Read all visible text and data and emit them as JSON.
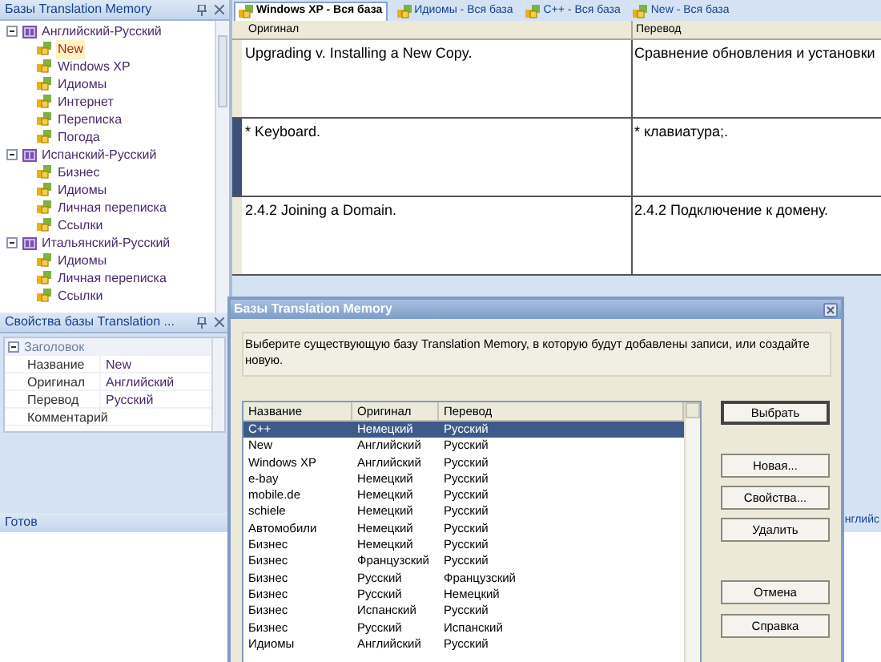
{
  "tm_panel": {
    "title": "Базы Translation Memory",
    "tree": [
      {
        "label": "Английский-Русский",
        "expanded": true,
        "children": [
          {
            "label": "New",
            "selected": true
          },
          {
            "label": "Windows XP",
            "selected": false
          },
          {
            "label": "Идиомы",
            "selected": false
          },
          {
            "label": "Интернет",
            "selected": false
          },
          {
            "label": "Переписка",
            "selected": false
          },
          {
            "label": "Погода",
            "selected": false
          }
        ]
      },
      {
        "label": "Испанский-Русский",
        "expanded": true,
        "children": [
          {
            "label": "Бизнес",
            "selected": false
          },
          {
            "label": "Идиомы",
            "selected": false
          },
          {
            "label": "Личная переписка",
            "selected": false
          },
          {
            "label": "Ссылки",
            "selected": false
          }
        ]
      },
      {
        "label": "Итальянский-Русский",
        "expanded": true,
        "children": [
          {
            "label": "Идиомы",
            "selected": false
          },
          {
            "label": "Личная переписка",
            "selected": false
          },
          {
            "label": "Ссылки",
            "selected": false
          }
        ]
      }
    ]
  },
  "props_panel": {
    "title": "Свойства базы Translation ...",
    "category": "Заголовок",
    "rows": [
      {
        "name": "Название",
        "value": "New"
      },
      {
        "name": "Оригинал",
        "value": "Английский"
      },
      {
        "name": "Перевод",
        "value": "Русский"
      },
      {
        "name": "Комментарий"
      }
    ]
  },
  "status_bar": {
    "text": "Готов",
    "right_text": "нглийс"
  },
  "tabs": [
    {
      "label": "Windows XP - Вся база",
      "selected": true
    },
    {
      "label": "Идиомы - Вся база",
      "selected": false
    },
    {
      "label": "C++ - Вся база",
      "selected": false
    },
    {
      "label": "New - Вся база",
      "selected": false
    }
  ],
  "table": {
    "columns": [
      "Оригинал",
      "Перевод"
    ],
    "rows": [
      {
        "original": "Upgrading v. Installing a New Copy.",
        "translation": "Сравнение обновления и установки",
        "selected": false
      },
      {
        "original": "* Keyboard.",
        "translation": "* клавиатура;.",
        "selected": true
      },
      {
        "original": "2.4.2   Joining a Domain.",
        "translation": "2.4.2 Подключение к домену.",
        "selected": false
      }
    ]
  },
  "dialog": {
    "title": "Базы Translation Memory",
    "message": "Выберите существующую базу Translation Memory, в которую будут добавлены записи, или создайте новую.",
    "columns": [
      "Название",
      "Оригинал",
      "Перевод"
    ],
    "rows": [
      {
        "name": "C++",
        "original": "Немецкий",
        "translation": "Русский",
        "selected": true
      },
      {
        "name": "New",
        "original": "Английский",
        "translation": "Русский",
        "selected": false
      },
      {
        "name": "Windows XP",
        "original": "Английский",
        "translation": "Русский",
        "selected": false
      },
      {
        "name": "e-bay",
        "original": "Немецкий",
        "translation": "Русский",
        "selected": false
      },
      {
        "name": "mobile.de",
        "original": "Немецкий",
        "translation": "Русский",
        "selected": false
      },
      {
        "name": "schiele",
        "original": "Немецкий",
        "translation": "Русский",
        "selected": false
      },
      {
        "name": "Автомобили",
        "original": "Немецкий",
        "translation": "Русский",
        "selected": false
      },
      {
        "name": "Бизнес",
        "original": "Немецкий",
        "translation": "Русский",
        "selected": false
      },
      {
        "name": "Бизнес",
        "original": "Французский",
        "translation": "Русский",
        "selected": false
      },
      {
        "name": "Бизнес",
        "original": "Русский",
        "translation": "Французский",
        "selected": false
      },
      {
        "name": "Бизнес",
        "original": "Русский",
        "translation": "Немецкий",
        "selected": false
      },
      {
        "name": "Бизнес",
        "original": "Испанский",
        "translation": "Русский",
        "selected": false
      },
      {
        "name": "Бизнес",
        "original": "Русский",
        "translation": "Испанский",
        "selected": false
      },
      {
        "name": "Идиомы",
        "original": "Английский",
        "translation": "Русский",
        "selected": false
      }
    ],
    "buttons": [
      {
        "label": "Выбрать",
        "kind": "default"
      },
      {
        "label": "Новая...",
        "kind": "normal"
      },
      {
        "label": "Свойства...",
        "kind": "normal"
      },
      {
        "label": "Удалить",
        "kind": "normal"
      },
      {
        "label": "Отмена",
        "kind": "normal"
      },
      {
        "label": "Справка",
        "kind": "normal"
      }
    ]
  }
}
